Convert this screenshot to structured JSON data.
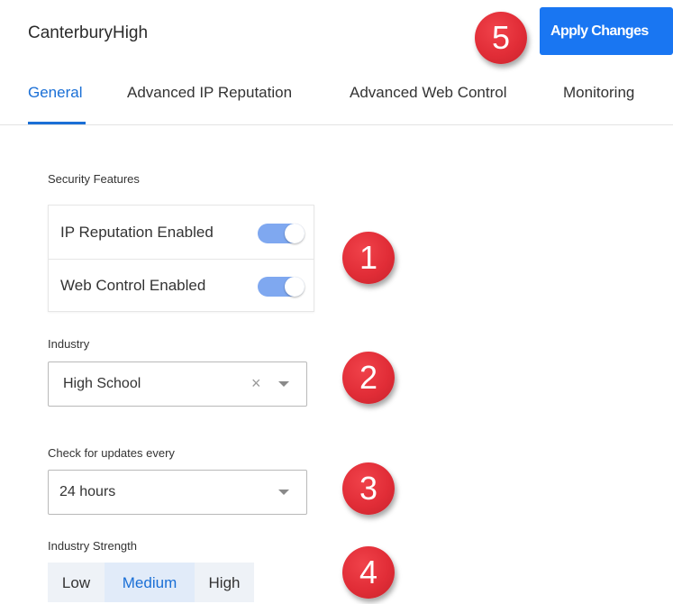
{
  "header": {
    "app_title": "CanterburyHigh",
    "apply_label": "Apply Changes"
  },
  "tabs": [
    {
      "label": "General",
      "active": true
    },
    {
      "label": "Advanced IP Reputation",
      "active": false
    },
    {
      "label": "Advanced Web Control",
      "active": false
    },
    {
      "label": "Monitoring",
      "active": false
    }
  ],
  "security": {
    "label": "Security Features",
    "features": [
      {
        "label": "IP Reputation Enabled",
        "enabled": true
      },
      {
        "label": "Web Control Enabled",
        "enabled": true
      }
    ]
  },
  "industry": {
    "label": "Industry",
    "value": "High School",
    "clear_glyph": "×"
  },
  "updates": {
    "label": "Check for updates every",
    "value": "24 hours"
  },
  "strength": {
    "label": "Industry Strength",
    "options": [
      "Low",
      "Medium",
      "High"
    ],
    "selected": "Medium"
  },
  "callouts": [
    "1",
    "2",
    "3",
    "4",
    "5"
  ],
  "colors": {
    "accent": "#1a6fd6",
    "button": "#1976f2",
    "toggle_on": "#7fa8f0",
    "callout": "#e12d37"
  }
}
